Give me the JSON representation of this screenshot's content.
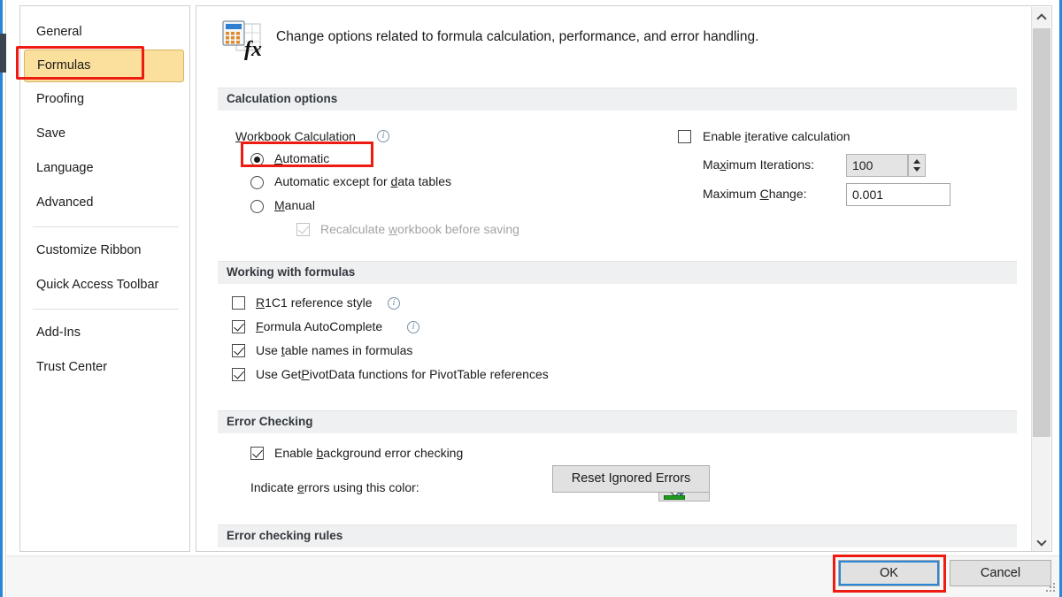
{
  "sidebar": {
    "items": [
      {
        "label": "General",
        "selected": false
      },
      {
        "label": "Formulas",
        "selected": true
      },
      {
        "label": "Proofing",
        "selected": false
      },
      {
        "label": "Save",
        "selected": false
      },
      {
        "label": "Language",
        "selected": false
      },
      {
        "label": "Advanced",
        "selected": false
      },
      {
        "label": "Customize Ribbon",
        "selected": false
      },
      {
        "label": "Quick Access Toolbar",
        "selected": false
      },
      {
        "label": "Add-Ins",
        "selected": false
      },
      {
        "label": "Trust Center",
        "selected": false
      }
    ]
  },
  "header": {
    "description": "Change options related to formula calculation, performance, and error handling.",
    "icon": "formulas-fx-icon"
  },
  "sections": {
    "calculation": {
      "title": "Calculation options",
      "workbook_calculation_label": "Workbook Calculation",
      "radios": [
        {
          "label_pre": "",
          "label_accel": "A",
          "label_post": "utomatic",
          "checked": true
        },
        {
          "label_pre": "Automatic except for ",
          "label_accel": "d",
          "label_post": "ata tables",
          "checked": false
        },
        {
          "label_pre": "",
          "label_accel": "M",
          "label_post": "anual",
          "checked": false
        }
      ],
      "recalculate_pre": "Recalculate ",
      "recalculate_accel": "w",
      "recalculate_post": "orkbook before saving",
      "recalculate_checked": true,
      "recalculate_disabled": true,
      "iterative": {
        "label_pre": "Enable ",
        "label_accel": "i",
        "label_post": "terative calculation",
        "checked": false
      },
      "max_iterations_label_pre": "Ma",
      "max_iterations_label_accel": "x",
      "max_iterations_label_post": "imum Iterations:",
      "max_iterations_value": "100",
      "max_change_label_pre": "Maximum ",
      "max_change_label_accel": "C",
      "max_change_label_post": "hange:",
      "max_change_value": "0.001"
    },
    "working_with_formulas": {
      "title": "Working with formulas",
      "checkboxes": [
        {
          "pre": "",
          "accel": "R",
          "post": "1C1 reference style",
          "checked": false,
          "info": true
        },
        {
          "pre": "",
          "accel": "F",
          "post": "ormula AutoComplete",
          "checked": true,
          "info": true
        },
        {
          "pre": "Use ",
          "accel": "t",
          "post": "able names in formulas",
          "checked": true,
          "info": false
        },
        {
          "pre": "Use Get",
          "accel": "P",
          "post": "ivotData functions for PivotTable references",
          "checked": true,
          "info": false
        }
      ]
    },
    "error_checking": {
      "title": "Error Checking",
      "enable_pre": "Enable ",
      "enable_accel": "b",
      "enable_post": "ackground error checking",
      "enable_checked": true,
      "indicate_pre": "Indicate ",
      "indicate_accel": "e",
      "indicate_post": "rrors using this color:",
      "color_value": "#1f9c1f",
      "reset_button_pre": "Reset I",
      "reset_button_accel": "g",
      "reset_button_post": "nored Errors"
    },
    "error_checking_rules": {
      "title": "Error checking rules"
    }
  },
  "footer": {
    "ok_label": "OK",
    "cancel_label": "Cancel"
  },
  "scrollbar": {
    "up_icon": "chevron-up-icon",
    "down_icon": "chevron-down-icon"
  },
  "annotations": {
    "accent_color": "#ee1b11"
  }
}
